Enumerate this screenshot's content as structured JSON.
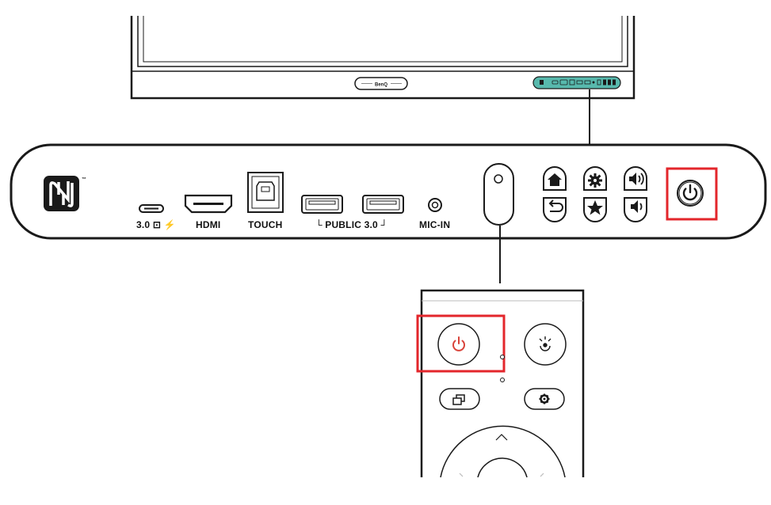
{
  "display": {
    "brand_badge": "BenQ"
  },
  "front_panel": {
    "ports": [
      {
        "key": "usb-c",
        "label": "3.0 ⊡ ⚡"
      },
      {
        "key": "hdmi",
        "label": "HDMI"
      },
      {
        "key": "touch",
        "label": "TOUCH"
      },
      {
        "key": "public",
        "label": "└ PUBLIC 3.0 ┘"
      },
      {
        "key": "mic",
        "label": "MIC-IN"
      }
    ],
    "buttons": [
      "home",
      "back",
      "settings",
      "favorite",
      "volume-up",
      "volume-down",
      "power"
    ]
  },
  "remote": {
    "buttons": [
      "power",
      "input-source",
      "multitask",
      "settings",
      "up"
    ]
  },
  "colors": {
    "highlight": "#e3262b",
    "remote_power": "#d9433a",
    "panel_teal": "#58b9ad",
    "line": "#1a1a1a"
  }
}
